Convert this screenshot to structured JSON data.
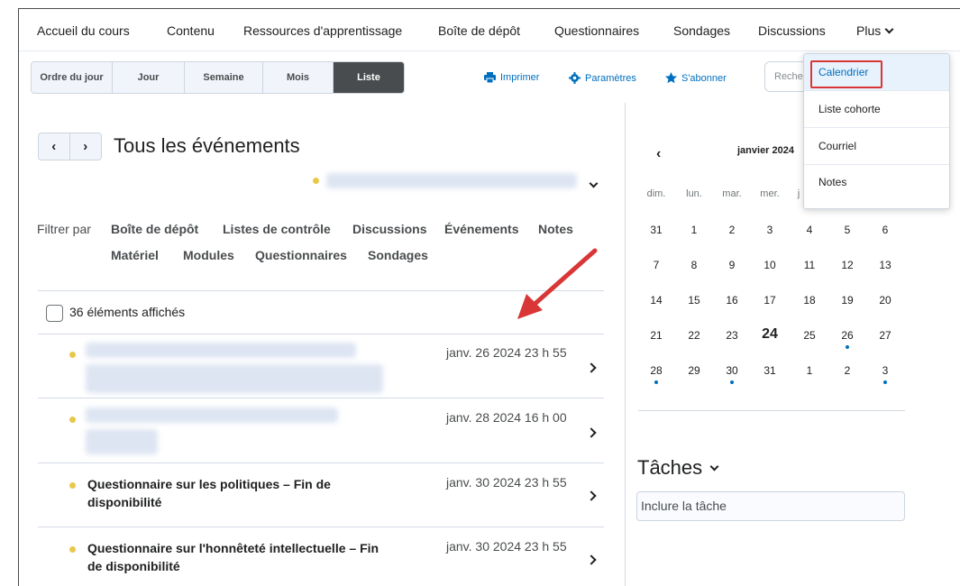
{
  "topnav": {
    "items": [
      "Accueil du cours",
      "Contenu",
      "Ressources d'apprentissage",
      "Boîte de dépôt",
      "Questionnaires",
      "Sondages",
      "Discussions"
    ],
    "more_label": "Plus"
  },
  "views": {
    "items": [
      "Ordre du jour",
      "Jour",
      "Semaine",
      "Mois",
      "Liste"
    ],
    "active": "Liste"
  },
  "tools": {
    "print": "Imprimer",
    "settings": "Paramètres",
    "subscribe": "S'abonner",
    "search_placeholder": "Rechercher"
  },
  "dropdown": {
    "items": [
      "Calendrier",
      "Liste cohorte",
      "Courriel",
      "Notes"
    ]
  },
  "events_panel": {
    "title": "Tous les événements",
    "filter_label": "Filtrer par",
    "filters": [
      "Boîte de dépôt",
      "Listes de contrôle",
      "Discussions",
      "Événements",
      "Notes",
      "Matériel",
      "Modules",
      "Questionnaires",
      "Sondages"
    ],
    "count_label": "36 éléments affichés",
    "events": [
      {
        "title": "",
        "date": "janv. 26 2024 23 h 55"
      },
      {
        "title": "",
        "date": "janv. 28 2024 16 h 00"
      },
      {
        "title": "Questionnaire sur les politiques – Fin de disponibilité",
        "date": "janv. 30 2024 23 h 55"
      },
      {
        "title": "Questionnaire sur l'honnêteté intellectuelle – Fin de disponibilité",
        "date": "janv. 30 2024 23 h 55"
      }
    ]
  },
  "calendar": {
    "month_label": "janvier 2024",
    "weekdays": [
      "dim.",
      "lun.",
      "mar.",
      "mer.",
      "j"
    ],
    "weeks": [
      [
        "31",
        "1",
        "2",
        "3",
        "4",
        "5",
        "6"
      ],
      [
        "7",
        "8",
        "9",
        "10",
        "11",
        "12",
        "13"
      ],
      [
        "14",
        "15",
        "16",
        "17",
        "18",
        "19",
        "20"
      ],
      [
        "21",
        "22",
        "23",
        "24",
        "25",
        "26",
        "27"
      ],
      [
        "28",
        "29",
        "30",
        "31",
        "1",
        "2",
        "3"
      ]
    ],
    "today": "24"
  },
  "tasks": {
    "title": "Tâches",
    "input_placeholder": "Inclure la tâche"
  },
  "colors": {
    "accent": "#006fbf",
    "highlight": "#d93636",
    "event_dot": "#e8c84a",
    "active_view": "#494c4e"
  }
}
